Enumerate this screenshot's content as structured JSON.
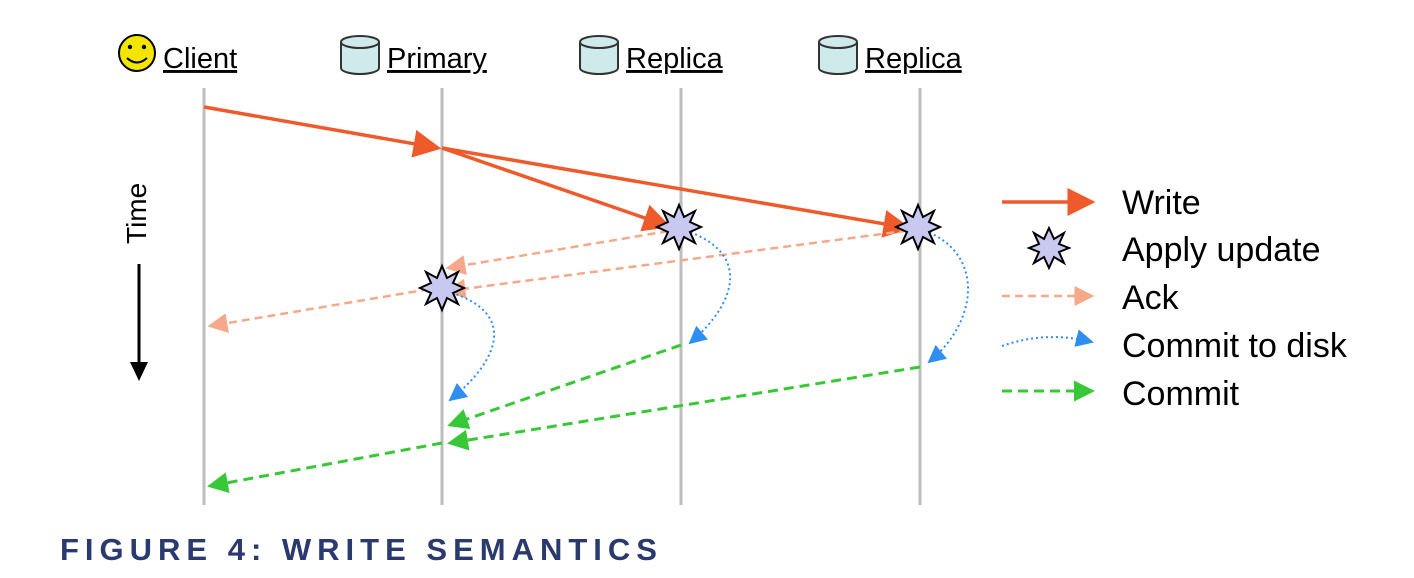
{
  "participants": [
    {
      "label": "Client",
      "icon": "smiley-icon"
    },
    {
      "label": "Primary",
      "icon": "database-icon"
    },
    {
      "label": "Replica",
      "icon": "database-icon"
    },
    {
      "label": "Replica",
      "icon": "database-icon"
    }
  ],
  "time_label": "Time",
  "legend": [
    {
      "label": "Write",
      "style": "solid",
      "color": "#ef5a2b"
    },
    {
      "label": "Apply update",
      "style": "starburst",
      "color": "#c9c8f0"
    },
    {
      "label": "Ack",
      "style": "dashed",
      "color": "#f5a98a"
    },
    {
      "label": "Commit to disk",
      "style": "dotted",
      "color": "#2f8ff0"
    },
    {
      "label": "Commit",
      "style": "dashed",
      "color": "#37c837"
    }
  ],
  "caption": "FIGURE 4: WRITE SEMANTICS",
  "colors": {
    "lifeline": "#bdbdbd",
    "write": "#ef5a2b",
    "ack": "#f5a98a",
    "disk": "#2f8ff0",
    "commit": "#37c837",
    "smiley": "#f2e600",
    "db": "#cfeaea",
    "caption": "#2a3a6e"
  }
}
